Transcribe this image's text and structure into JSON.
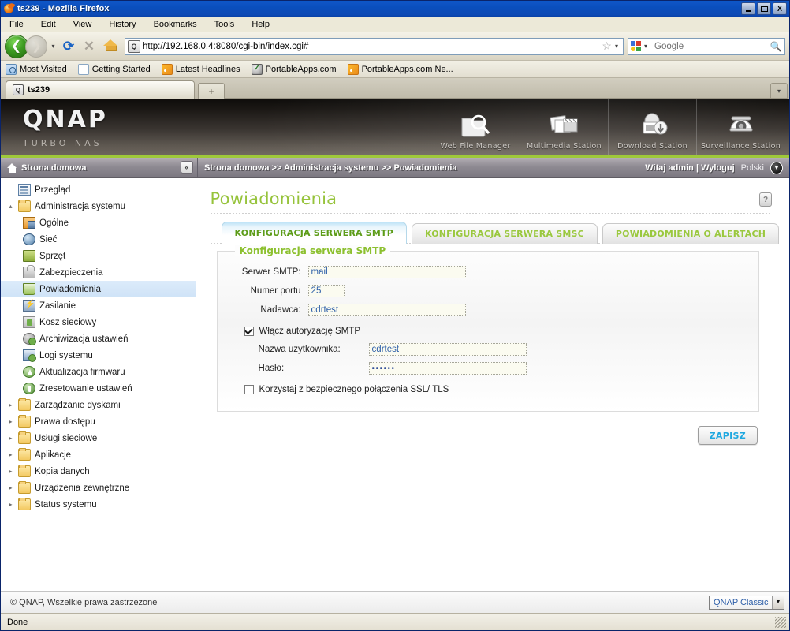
{
  "window": {
    "title": "ts239 - Mozilla Firefox",
    "minimize_label": "_",
    "maximize_label": "□",
    "close_label": "X"
  },
  "menubar": {
    "items": [
      "File",
      "Edit",
      "View",
      "History",
      "Bookmarks",
      "Tools",
      "Help"
    ]
  },
  "toolbar": {
    "back_glyph": "❮",
    "forward_glyph": "❯",
    "history_caret": "▾",
    "reload_glyph": "⟳",
    "stop_glyph": "✕",
    "home_label": "Home",
    "url": "http://192.168.0.4:8080/cgi-bin/index.cgi#",
    "url_favicon": "Q",
    "star_glyph": "☆",
    "url_caret": "▾",
    "search_placeholder": "Google",
    "search_caret": "▾",
    "search_glyph": "🔍"
  },
  "bookmarks": {
    "items": [
      {
        "label": "Most Visited",
        "icon": "most-visited-icon"
      },
      {
        "label": "Getting Started",
        "icon": "document-icon"
      },
      {
        "label": "Latest Headlines",
        "icon": "rss-icon"
      },
      {
        "label": "PortableApps.com",
        "icon": "portableapps-icon"
      },
      {
        "label": "PortableApps.com Ne...",
        "icon": "rss-icon"
      }
    ]
  },
  "tabs": {
    "browser_tab_label": "ts239",
    "browser_tab_favicon": "Q",
    "new_tab_glyph": "+",
    "tab_list_glyph": "▾"
  },
  "banner": {
    "logo": "QNAP",
    "tagline": "TURBO NAS",
    "apps": [
      {
        "label": "Web File Manager",
        "icon": "folder-search-icon"
      },
      {
        "label": "Multimedia Station",
        "icon": "photo-clapboard-icon"
      },
      {
        "label": "Download Station",
        "icon": "download-monitor-icon"
      },
      {
        "label": "Surveillance Station",
        "icon": "dome-camera-icon"
      }
    ],
    "accent_color": "#9fc93a"
  },
  "subheader": {
    "home_label": "Strona domowa",
    "collapse_glyph": "«",
    "breadcrumb": "Strona domowa >> Administracja systemu >> Powiadomienia",
    "greeting": "Witaj admin  |  Wyloguj",
    "language": "Polski",
    "language_caret": "▼"
  },
  "sidebar": {
    "items": [
      {
        "label": "Przegląd",
        "level": 1,
        "icon": "overview-icon",
        "twisty": "",
        "selected": false
      },
      {
        "label": "Administracja systemu",
        "level": 1,
        "icon": "folder-open-icon",
        "twisty": "▴",
        "selected": false
      },
      {
        "label": "Ogólne",
        "level": 2,
        "icon": "general-icon",
        "twisty": "",
        "selected": false
      },
      {
        "label": "Sieć",
        "level": 2,
        "icon": "network-icon",
        "twisty": "",
        "selected": false
      },
      {
        "label": "Sprzęt",
        "level": 2,
        "icon": "hardware-icon",
        "twisty": "",
        "selected": false
      },
      {
        "label": "Zabezpieczenia",
        "level": 2,
        "icon": "lock-icon",
        "twisty": "",
        "selected": false
      },
      {
        "label": "Powiadomienia",
        "level": 2,
        "icon": "notification-icon",
        "twisty": "",
        "selected": true
      },
      {
        "label": "Zasilanie",
        "level": 2,
        "icon": "power-icon",
        "twisty": "",
        "selected": false
      },
      {
        "label": "Kosz sieciowy",
        "level": 2,
        "icon": "trash-icon",
        "twisty": "",
        "selected": false
      },
      {
        "label": "Archiwizacja ustawień",
        "level": 2,
        "icon": "backup-icon",
        "twisty": "",
        "selected": false
      },
      {
        "label": "Logi systemu",
        "level": 2,
        "icon": "logs-icon",
        "twisty": "",
        "selected": false
      },
      {
        "label": "Aktualizacja firmwaru",
        "level": 2,
        "icon": "firmware-up-icon",
        "twisty": "",
        "selected": false
      },
      {
        "label": "Zresetowanie ustawień",
        "level": 2,
        "icon": "reset-icon",
        "twisty": "",
        "selected": false
      },
      {
        "label": "Zarządzanie dyskami",
        "level": 1,
        "icon": "folder-icon",
        "twisty": "▸",
        "selected": false
      },
      {
        "label": "Prawa dostępu",
        "level": 1,
        "icon": "folder-icon",
        "twisty": "▸",
        "selected": false
      },
      {
        "label": "Usługi sieciowe",
        "level": 1,
        "icon": "folder-icon",
        "twisty": "▸",
        "selected": false
      },
      {
        "label": "Aplikacje",
        "level": 1,
        "icon": "folder-icon",
        "twisty": "▸",
        "selected": false
      },
      {
        "label": "Kopia danych",
        "level": 1,
        "icon": "folder-icon",
        "twisty": "▸",
        "selected": false
      },
      {
        "label": "Urządzenia zewnętrzne",
        "level": 1,
        "icon": "folder-icon",
        "twisty": "▸",
        "selected": false
      },
      {
        "label": "Status systemu",
        "level": 1,
        "icon": "folder-icon",
        "twisty": "▸",
        "selected": false
      }
    ]
  },
  "main": {
    "page_title": "Powiadomienia",
    "help_glyph": "?",
    "tabs": [
      {
        "label": "KONFIGURACJA SERWERA SMTP",
        "active": true
      },
      {
        "label": "KONFIGURACJA SERWERA SMSC",
        "active": false
      },
      {
        "label": "POWIADOMIENIA O ALERTACH",
        "active": false
      }
    ],
    "fieldset_title": "Konfiguracja serwera SMTP",
    "fields": {
      "smtp_server_label": "Serwer SMTP:",
      "smtp_server_value": "mail",
      "port_label": "Numer portu",
      "port_value": "25",
      "sender_label": "Nadawca:",
      "sender_value": "cdrtest",
      "auth_checkbox_label": "Włącz autoryzację SMTP",
      "auth_checked": true,
      "username_label": "Nazwa użytkownika:",
      "username_value": "cdrtest",
      "password_label": "Hasło:",
      "password_value": "••••••",
      "ssl_checkbox_label": "Korzystaj z bezpiecznego połączenia SSL/ TLS",
      "ssl_checked": false
    },
    "save_label": "ZAPISZ"
  },
  "page_footer": {
    "copyright": "© QNAP, Wszelkie prawa zastrzeżone",
    "theme_value": "QNAP Classic",
    "theme_caret": "▼"
  },
  "status_bar": {
    "text": "Done"
  },
  "colors": {
    "qnap_green": "#9fc93a",
    "title_green": "#96c33b",
    "tab_green": "#5d9c18",
    "save_blue": "#1fa8e0",
    "input_value_blue": "#2c5ea8",
    "titlebar_blue": "#0a4fbd"
  }
}
